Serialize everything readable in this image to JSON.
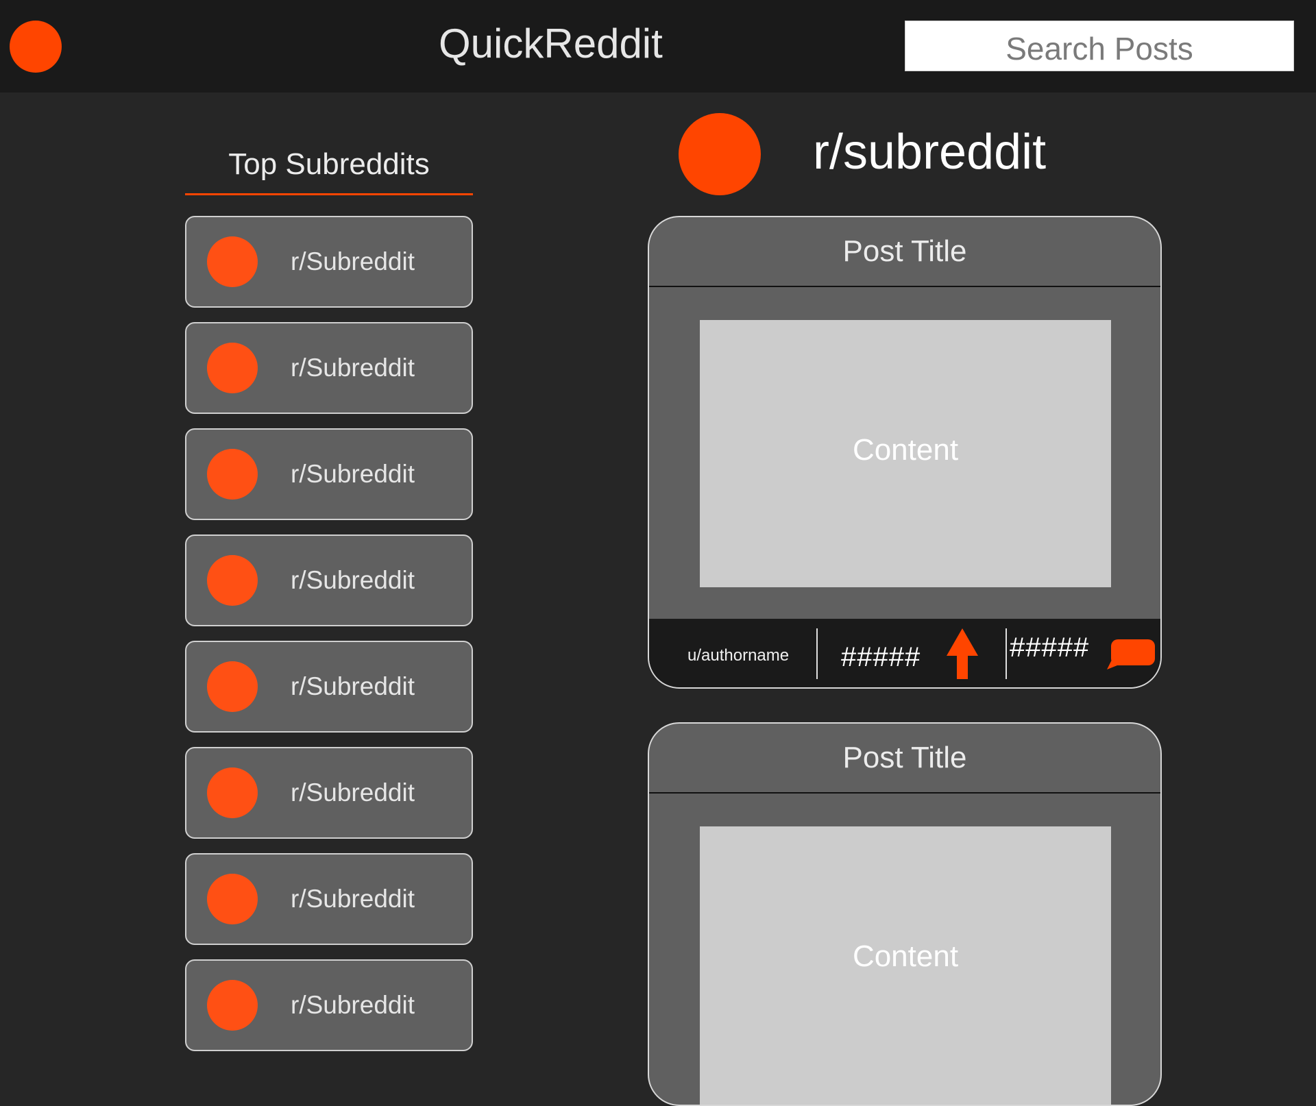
{
  "header": {
    "app_title": "QuickReddit",
    "search_placeholder": "Search Posts",
    "logo_icon": "reddit-logo-icon",
    "accent_color": "#ff4500"
  },
  "sidebar": {
    "heading": "Top Subreddits",
    "items": [
      {
        "label": "r/Subreddit",
        "icon": "subreddit-avatar-icon"
      },
      {
        "label": "r/Subreddit",
        "icon": "subreddit-avatar-icon"
      },
      {
        "label": "r/Subreddit",
        "icon": "subreddit-avatar-icon"
      },
      {
        "label": "r/Subreddit",
        "icon": "subreddit-avatar-icon"
      },
      {
        "label": "r/Subreddit",
        "icon": "subreddit-avatar-icon"
      },
      {
        "label": "r/Subreddit",
        "icon": "subreddit-avatar-icon"
      },
      {
        "label": "r/Subreddit",
        "icon": "subreddit-avatar-icon"
      },
      {
        "label": "r/Subreddit",
        "icon": "subreddit-avatar-icon"
      }
    ]
  },
  "main": {
    "subreddit_title": "r/subreddit",
    "posts": [
      {
        "title": "Post Title",
        "content": "Content",
        "author": "u/authorname",
        "votes": "#####",
        "comments": "#####"
      },
      {
        "title": "Post Title",
        "content": "Content"
      }
    ]
  },
  "colors": {
    "background": "#262626",
    "topbar": "#1a1a1a",
    "card": "#606060",
    "content_placeholder": "#cccccc",
    "accent": "#ff4500"
  }
}
